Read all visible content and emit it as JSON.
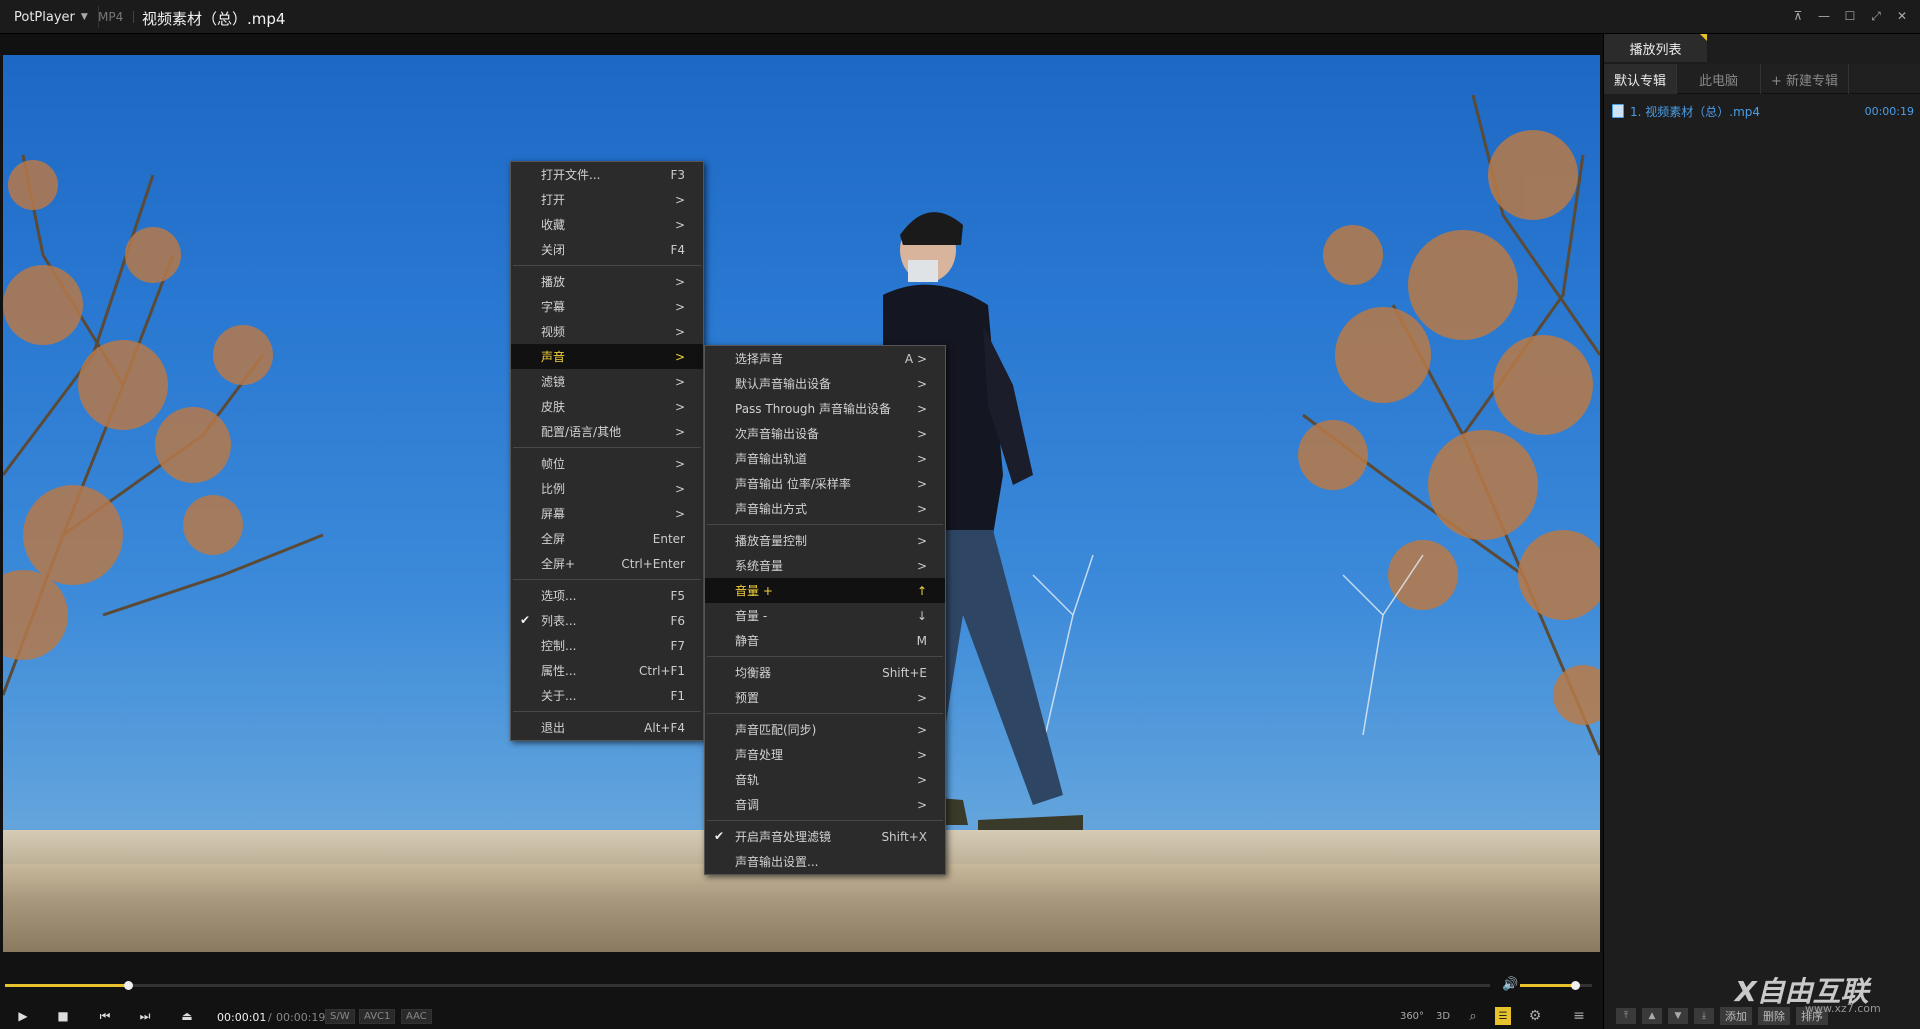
{
  "titlebar": {
    "app_name": "PotPlayer",
    "format": "MP4",
    "title": "视频素材（总）.mp4",
    "buttons": [
      "pin-icon",
      "minimize-icon",
      "maximize-icon",
      "fullscreen-icon",
      "close-icon"
    ]
  },
  "controls": {
    "time_current": "00:00:01",
    "time_separator": "/",
    "time_total": "00:00:19",
    "codecs": [
      "S/W",
      "AVC1",
      "AAC"
    ],
    "seek_progress": 0.083,
    "volume_level": 0.77,
    "right_buttons": [
      "360°",
      "3D"
    ]
  },
  "playlist": {
    "tab": "播放列表",
    "subtabs": [
      "默认专辑",
      "此电脑",
      "+ 新建专辑"
    ],
    "item_title": "1. 视频素材（总）.mp4",
    "item_duration": "00:00:19",
    "bottom_buttons": [
      "添加",
      "删除",
      "排序"
    ]
  },
  "main_menu": [
    {
      "label": "打开文件...",
      "shortcut": "F3"
    },
    {
      "label": "打开",
      "shortcut": ">"
    },
    {
      "label": "收藏",
      "shortcut": ">"
    },
    {
      "label": "关闭",
      "shortcut": "F4"
    },
    {
      "sep": true
    },
    {
      "label": "播放",
      "shortcut": ">"
    },
    {
      "label": "字幕",
      "shortcut": ">"
    },
    {
      "label": "视频",
      "shortcut": ">"
    },
    {
      "label": "声音",
      "shortcut": ">",
      "highlight": true
    },
    {
      "label": "滤镜",
      "shortcut": ">"
    },
    {
      "label": "皮肤",
      "shortcut": ">"
    },
    {
      "label": "配置/语言/其他",
      "shortcut": ">"
    },
    {
      "sep": true
    },
    {
      "label": "帧位",
      "shortcut": ">"
    },
    {
      "label": "比例",
      "shortcut": ">"
    },
    {
      "label": "屏幕",
      "shortcut": ">"
    },
    {
      "label": "全屏",
      "shortcut": "Enter"
    },
    {
      "label": "全屏+",
      "shortcut": "Ctrl+Enter"
    },
    {
      "sep": true
    },
    {
      "label": "选项...",
      "shortcut": "F5"
    },
    {
      "label": "列表...",
      "shortcut": "F6",
      "checked": true
    },
    {
      "label": "控制...",
      "shortcut": "F7"
    },
    {
      "label": "属性...",
      "shortcut": "Ctrl+F1"
    },
    {
      "label": "关于...",
      "shortcut": "F1"
    },
    {
      "sep": true
    },
    {
      "label": "退出",
      "shortcut": "Alt+F4"
    }
  ],
  "sound_menu": [
    {
      "label": "选择声音",
      "shortcut": "A >"
    },
    {
      "label": "默认声音输出设备",
      "shortcut": ">"
    },
    {
      "label": "Pass Through 声音输出设备",
      "shortcut": ">"
    },
    {
      "label": "次声音输出设备",
      "shortcut": ">"
    },
    {
      "label": "声音输出轨道",
      "shortcut": ">"
    },
    {
      "label": "声音输出 位率/采样率",
      "shortcut": ">"
    },
    {
      "label": "声音输出方式",
      "shortcut": ">"
    },
    {
      "sep": true
    },
    {
      "label": "播放音量控制",
      "shortcut": ">"
    },
    {
      "label": "系统音量",
      "shortcut": ">"
    },
    {
      "label": "音量 +",
      "shortcut": "↑",
      "highlight": true
    },
    {
      "label": "音量 -",
      "shortcut": "↓"
    },
    {
      "label": "静音",
      "shortcut": "M"
    },
    {
      "sep": true
    },
    {
      "label": "均衡器",
      "shortcut": "Shift+E"
    },
    {
      "label": "预置",
      "shortcut": ">"
    },
    {
      "sep": true
    },
    {
      "label": "声音匹配(同步)",
      "shortcut": ">"
    },
    {
      "label": "声音处理",
      "shortcut": ">"
    },
    {
      "label": "音轨",
      "shortcut": ">"
    },
    {
      "label": "音调",
      "shortcut": ">"
    },
    {
      "sep": true
    },
    {
      "label": "开启声音处理滤镜",
      "shortcut": "Shift+X",
      "checked": true
    },
    {
      "label": "声音输出设置..."
    }
  ],
  "watermark": {
    "text": "X自由互联",
    "url": "www.xz7.com"
  },
  "colors": {
    "accent": "#e8c22c",
    "menu_highlight_text": "#f3d23d",
    "link": "#4a9ee8",
    "background": "#1b1b1b"
  }
}
